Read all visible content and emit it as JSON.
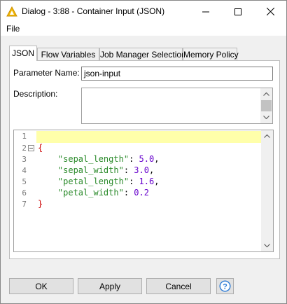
{
  "window": {
    "title": "Dialog - 3:88 - Container Input (JSON)",
    "accent_color": "#e8a800"
  },
  "menu": {
    "items": [
      {
        "label": "File"
      }
    ]
  },
  "tabs": [
    {
      "label": "JSON",
      "active": true
    },
    {
      "label": "Flow Variables",
      "active": false
    },
    {
      "label": "Job Manager Selection",
      "active": false
    },
    {
      "label": "Memory Policy",
      "active": false
    }
  ],
  "form": {
    "parameter_name_label": "Parameter Name:",
    "parameter_name_value": "json-input",
    "description_label": "Description:",
    "description_value": ""
  },
  "editor": {
    "line_numbers": [
      "1",
      "2",
      "3",
      "4",
      "5",
      "6",
      "7"
    ],
    "lines": {
      "open": "{",
      "close": "}",
      "entries": [
        {
          "key": "\"sepal_length\"",
          "value": "5.0",
          "suffix": ","
        },
        {
          "key": "\"sepal_width\"",
          "value": "3.0",
          "suffix": ","
        },
        {
          "key": "\"petal_length\"",
          "value": "1.6",
          "suffix": ","
        },
        {
          "key": "\"petal_width\"",
          "value": "0.2",
          "suffix": ""
        }
      ]
    },
    "colors": {
      "brace": "#cc0000",
      "key": "#2a8a2a",
      "number": "#6600cc",
      "current_line": "#ffffaa"
    }
  },
  "buttons": {
    "ok": "OK",
    "apply": "Apply",
    "cancel": "Cancel",
    "help_icon": "help-icon"
  }
}
